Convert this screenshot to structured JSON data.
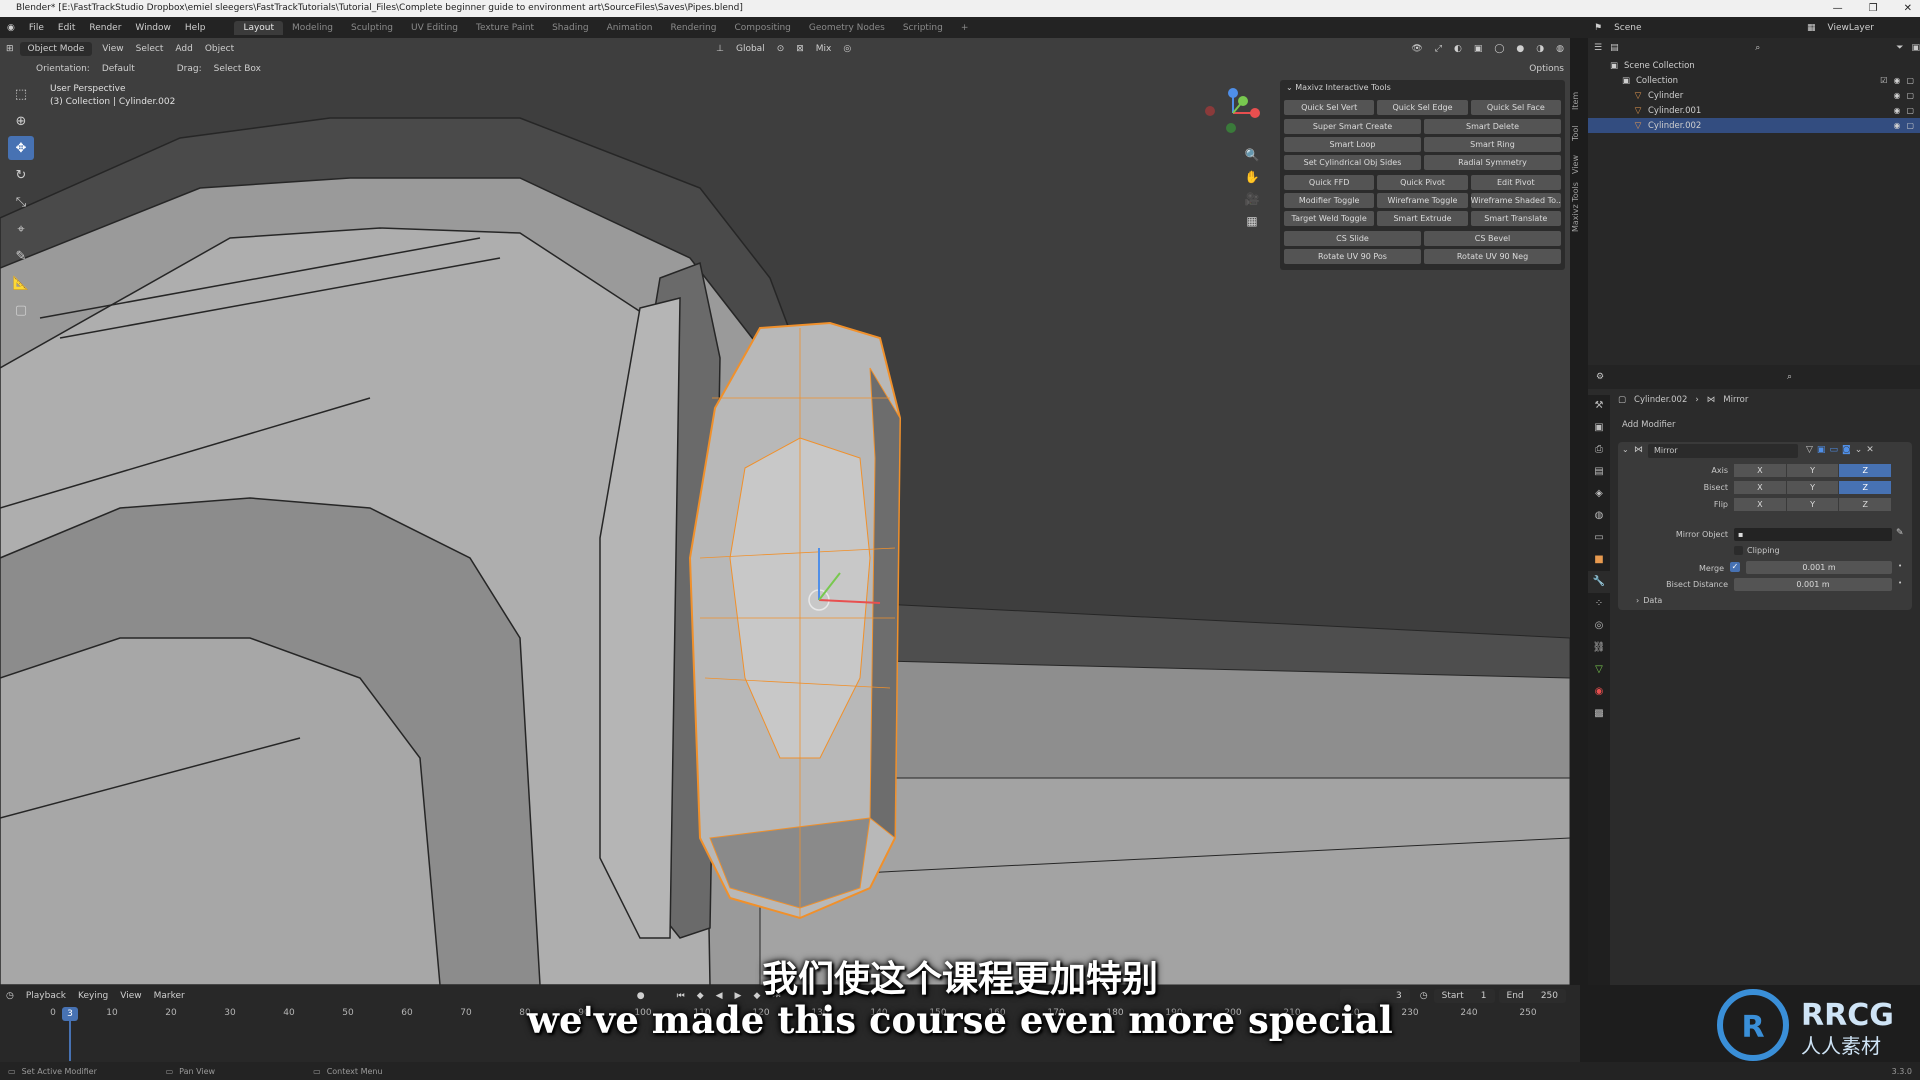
{
  "window": {
    "title": "Blender* [E:\\FastTrackStudio Dropbox\\emiel sleegers\\FastTrackTutorials\\Tutorial_Files\\Complete beginner guide to environment art\\SourceFiles\\Saves\\Pipes.blend]",
    "controls": [
      "—",
      "❐",
      "✕"
    ]
  },
  "menu": {
    "items": [
      "File",
      "Edit",
      "Render",
      "Window",
      "Help"
    ],
    "workspaces": [
      "Layout",
      "Modeling",
      "Sculpting",
      "UV Editing",
      "Texture Paint",
      "Shading",
      "Animation",
      "Rendering",
      "Compositing",
      "Geometry Nodes",
      "Scripting",
      "+"
    ],
    "active_workspace": "Layout",
    "scene": "Scene",
    "view_layer": "ViewLayer"
  },
  "viewport_header": {
    "mode": "Object Mode",
    "menus": [
      "View",
      "Select",
      "Add",
      "Object"
    ],
    "transform_orientation": "Global",
    "snap": "Mix",
    "orientation_label": "Orientation:",
    "orientation_value": "Default",
    "drag_label": "Drag:",
    "drag_value": "Select Box",
    "options": "Options"
  },
  "viewport_info": {
    "view": "User Perspective",
    "collection": "(3) Collection | Cylinder.002"
  },
  "toolbar": {
    "tools": [
      "select-box",
      "cursor",
      "move",
      "rotate",
      "scale",
      "transform",
      "annotate",
      "measure",
      "add-cube"
    ],
    "active": "move"
  },
  "maxivz": {
    "title": "Maxivz Interactive Tools",
    "rows3": [
      [
        "Quick Sel Vert",
        "Quick Sel Edge",
        "Quick Sel Face"
      ]
    ],
    "rows2a": [
      [
        "Super Smart Create",
        "Smart Delete"
      ],
      [
        "Smart Loop",
        "Smart Ring"
      ],
      [
        "Set Cylindrical Obj Sides",
        "Radial Symmetry"
      ]
    ],
    "rows3b": [
      [
        "Quick FFD",
        "Quick Pivot",
        "Edit Pivot"
      ],
      [
        "Modifier Toggle",
        "Wireframe Toggle",
        "Wireframe Shaded To.."
      ],
      [
        "Target Weld Toggle",
        "Smart Extrude",
        "Smart Translate"
      ]
    ],
    "rows2b": [
      [
        "CS Slide",
        "CS Bevel"
      ],
      [
        "Rotate UV 90 Pos",
        "Rotate UV 90 Neg"
      ]
    ],
    "side_tabs": [
      "Item",
      "Tool",
      "View",
      "Maxivz Tools"
    ]
  },
  "outliner": {
    "rows": [
      {
        "label": "Scene Collection",
        "indent": 0,
        "selected": false
      },
      {
        "label": "Collection",
        "indent": 1,
        "selected": false
      },
      {
        "label": "Cylinder",
        "indent": 2,
        "selected": false
      },
      {
        "label": "Cylinder.001",
        "indent": 2,
        "selected": false
      },
      {
        "label": "Cylinder.002",
        "indent": 2,
        "selected": true
      }
    ]
  },
  "properties": {
    "breadcrumb_object": "Cylinder.002",
    "breadcrumb_modifier": "Mirror",
    "add_modifier": "Add Modifier",
    "modifier_name": "Mirror",
    "axis_label": "Axis",
    "bisect_label": "Bisect",
    "flip_label": "Flip",
    "axes": [
      "X",
      "Y",
      "Z"
    ],
    "mirror_object_label": "Mirror Object",
    "clipping_label": "Clipping",
    "merge_label": "Merge",
    "merge_value": "0.001 m",
    "bisect_distance_label": "Bisect Distance",
    "bisect_distance_value": "0.001 m",
    "data_label": "Data"
  },
  "timeline": {
    "menus": [
      "Playback",
      "Keying",
      "View",
      "Marker"
    ],
    "current_frame": "3",
    "start_label": "Start",
    "start_value": "1",
    "end_label": "End",
    "end_value": "250",
    "ticks": [
      "0",
      "10",
      "20",
      "30",
      "40",
      "50",
      "60",
      "70",
      "80",
      "90",
      "100",
      "110",
      "120",
      "130",
      "140",
      "150",
      "160",
      "170",
      "180",
      "190",
      "200",
      "210",
      "220",
      "230",
      "240",
      "250"
    ],
    "playhead_label": "3"
  },
  "statusbar": {
    "left": "Set Active Modifier",
    "mid": "Pan View",
    "right": "Context Menu",
    "version": "3.3.0"
  },
  "subtitles": {
    "cn": "我们使这个课程更加特别",
    "en": "we've made this course even more special"
  },
  "watermark": {
    "brand": "RRCG",
    "cn": "人人素材"
  },
  "colors": {
    "accent": "#4772b3",
    "selection_orange": "#f0902b",
    "viewport_bg": "#3d3d3d"
  }
}
